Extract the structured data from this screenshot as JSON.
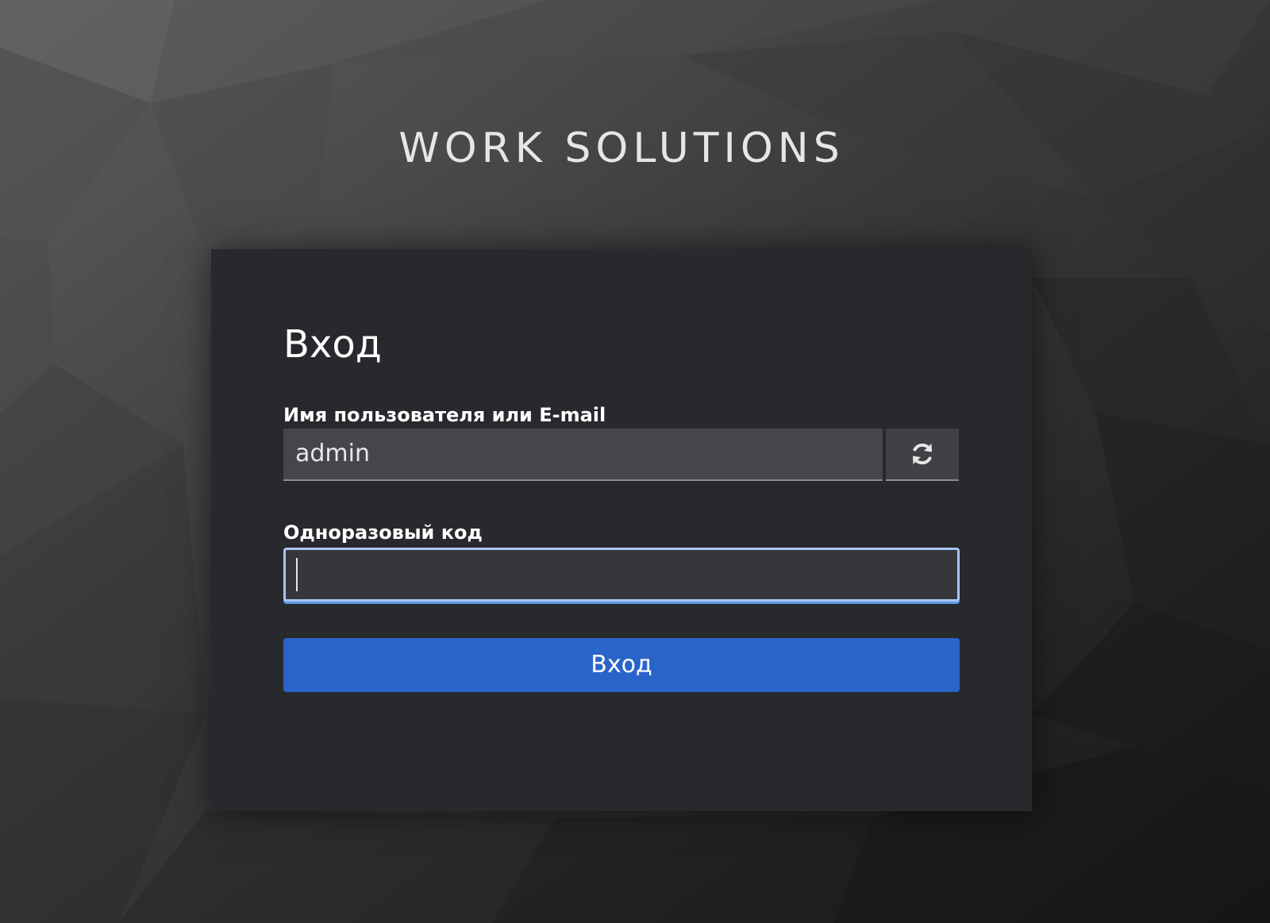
{
  "header": {
    "brand": "WORK SOLUTIONS"
  },
  "login": {
    "title": "Вход",
    "username": {
      "label": "Имя пользователя или E-mail",
      "value": "admin",
      "restart_icon": "refresh-icon"
    },
    "otp": {
      "label": "Одноразовый код",
      "value": ""
    },
    "submit_label": "Вход"
  },
  "colors": {
    "card_background": "#27292d",
    "primary_button": "#2b64c9",
    "focus_border": "#a9c5f0",
    "focus_underline": "#5b9ae8"
  }
}
